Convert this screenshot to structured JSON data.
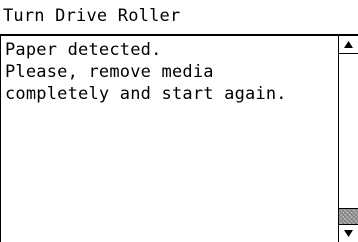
{
  "dialog": {
    "title": "Turn Drive Roller",
    "message_lines": [
      "Paper detected.",
      "Please, remove media",
      "completely and start again."
    ]
  },
  "scrollbar": {
    "up_icon": "triangle-up-icon",
    "down_icon": "triangle-down-icon",
    "position": 1.0
  },
  "colors": {
    "background": "#ffffff",
    "foreground": "#000000",
    "thumb": "#9a9a9a"
  }
}
